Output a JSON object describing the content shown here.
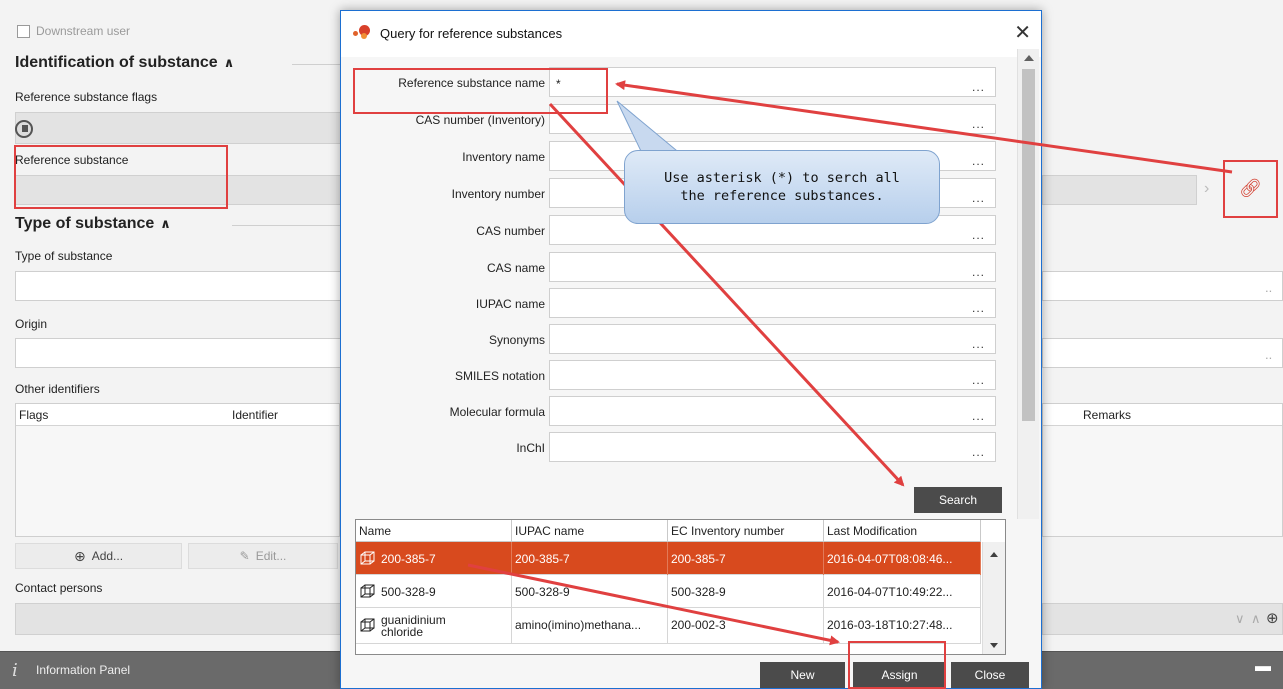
{
  "background": {
    "downstream_user_label": "Downstream user",
    "section_identification": "Identification of substance",
    "reference_substance_flags_label": "Reference substance flags",
    "reference_substance_label": "Reference substance",
    "section_type": "Type of substance",
    "type_of_substance_label": "Type of substance",
    "origin_label": "Origin",
    "other_identifiers_label": "Other identifiers",
    "grid_columns": [
      "Flags",
      "Identifier",
      "Remarks"
    ],
    "add_button": "Add...",
    "edit_button": "Edit...",
    "contact_persons_label": "Contact persons",
    "info_panel_label": "Information Panel"
  },
  "dialog": {
    "title": "Query for reference substances",
    "fields": [
      {
        "label": "Reference substance name",
        "value": "*"
      },
      {
        "label": "CAS number (Inventory)",
        "value": ""
      },
      {
        "label": "Inventory name",
        "value": ""
      },
      {
        "label": "Inventory number",
        "value": ""
      },
      {
        "label": "CAS number",
        "value": ""
      },
      {
        "label": "CAS name",
        "value": ""
      },
      {
        "label": "IUPAC name",
        "value": ""
      },
      {
        "label": "Synonyms",
        "value": ""
      },
      {
        "label": "SMILES notation",
        "value": ""
      },
      {
        "label": "Molecular formula",
        "value": ""
      },
      {
        "label": "InChI",
        "value": ""
      }
    ],
    "ellipsis": "...",
    "search_button": "Search",
    "results": {
      "columns": [
        "Name",
        "IUPAC name",
        "EC Inventory number",
        "Last Modification"
      ],
      "rows": [
        {
          "name": "200-385-7",
          "iupac": "200-385-7",
          "ec": "200-385-7",
          "modified": "2016-04-07T08:08:46...",
          "selected": true
        },
        {
          "name": "500-328-9",
          "iupac": "500-328-9",
          "ec": "500-328-9",
          "modified": "2016-04-07T10:49:22...",
          "selected": false
        },
        {
          "name_line1": "guanidinium",
          "name_line2": "chloride",
          "iupac": "amino(imino)methana...",
          "ec": "200-002-3",
          "modified": "2016-03-18T10:27:48...",
          "selected": false
        }
      ]
    },
    "buttons": {
      "new": "New",
      "assign": "Assign",
      "close": "Close"
    }
  },
  "annotation": {
    "callout_text": "Use asterisk (*) to serch all the reference substances."
  },
  "colors": {
    "accent_red": "#e04040",
    "selection": "#d84a1e",
    "dark_button": "#4b4b4b",
    "dialog_border": "#1c6fd1"
  }
}
